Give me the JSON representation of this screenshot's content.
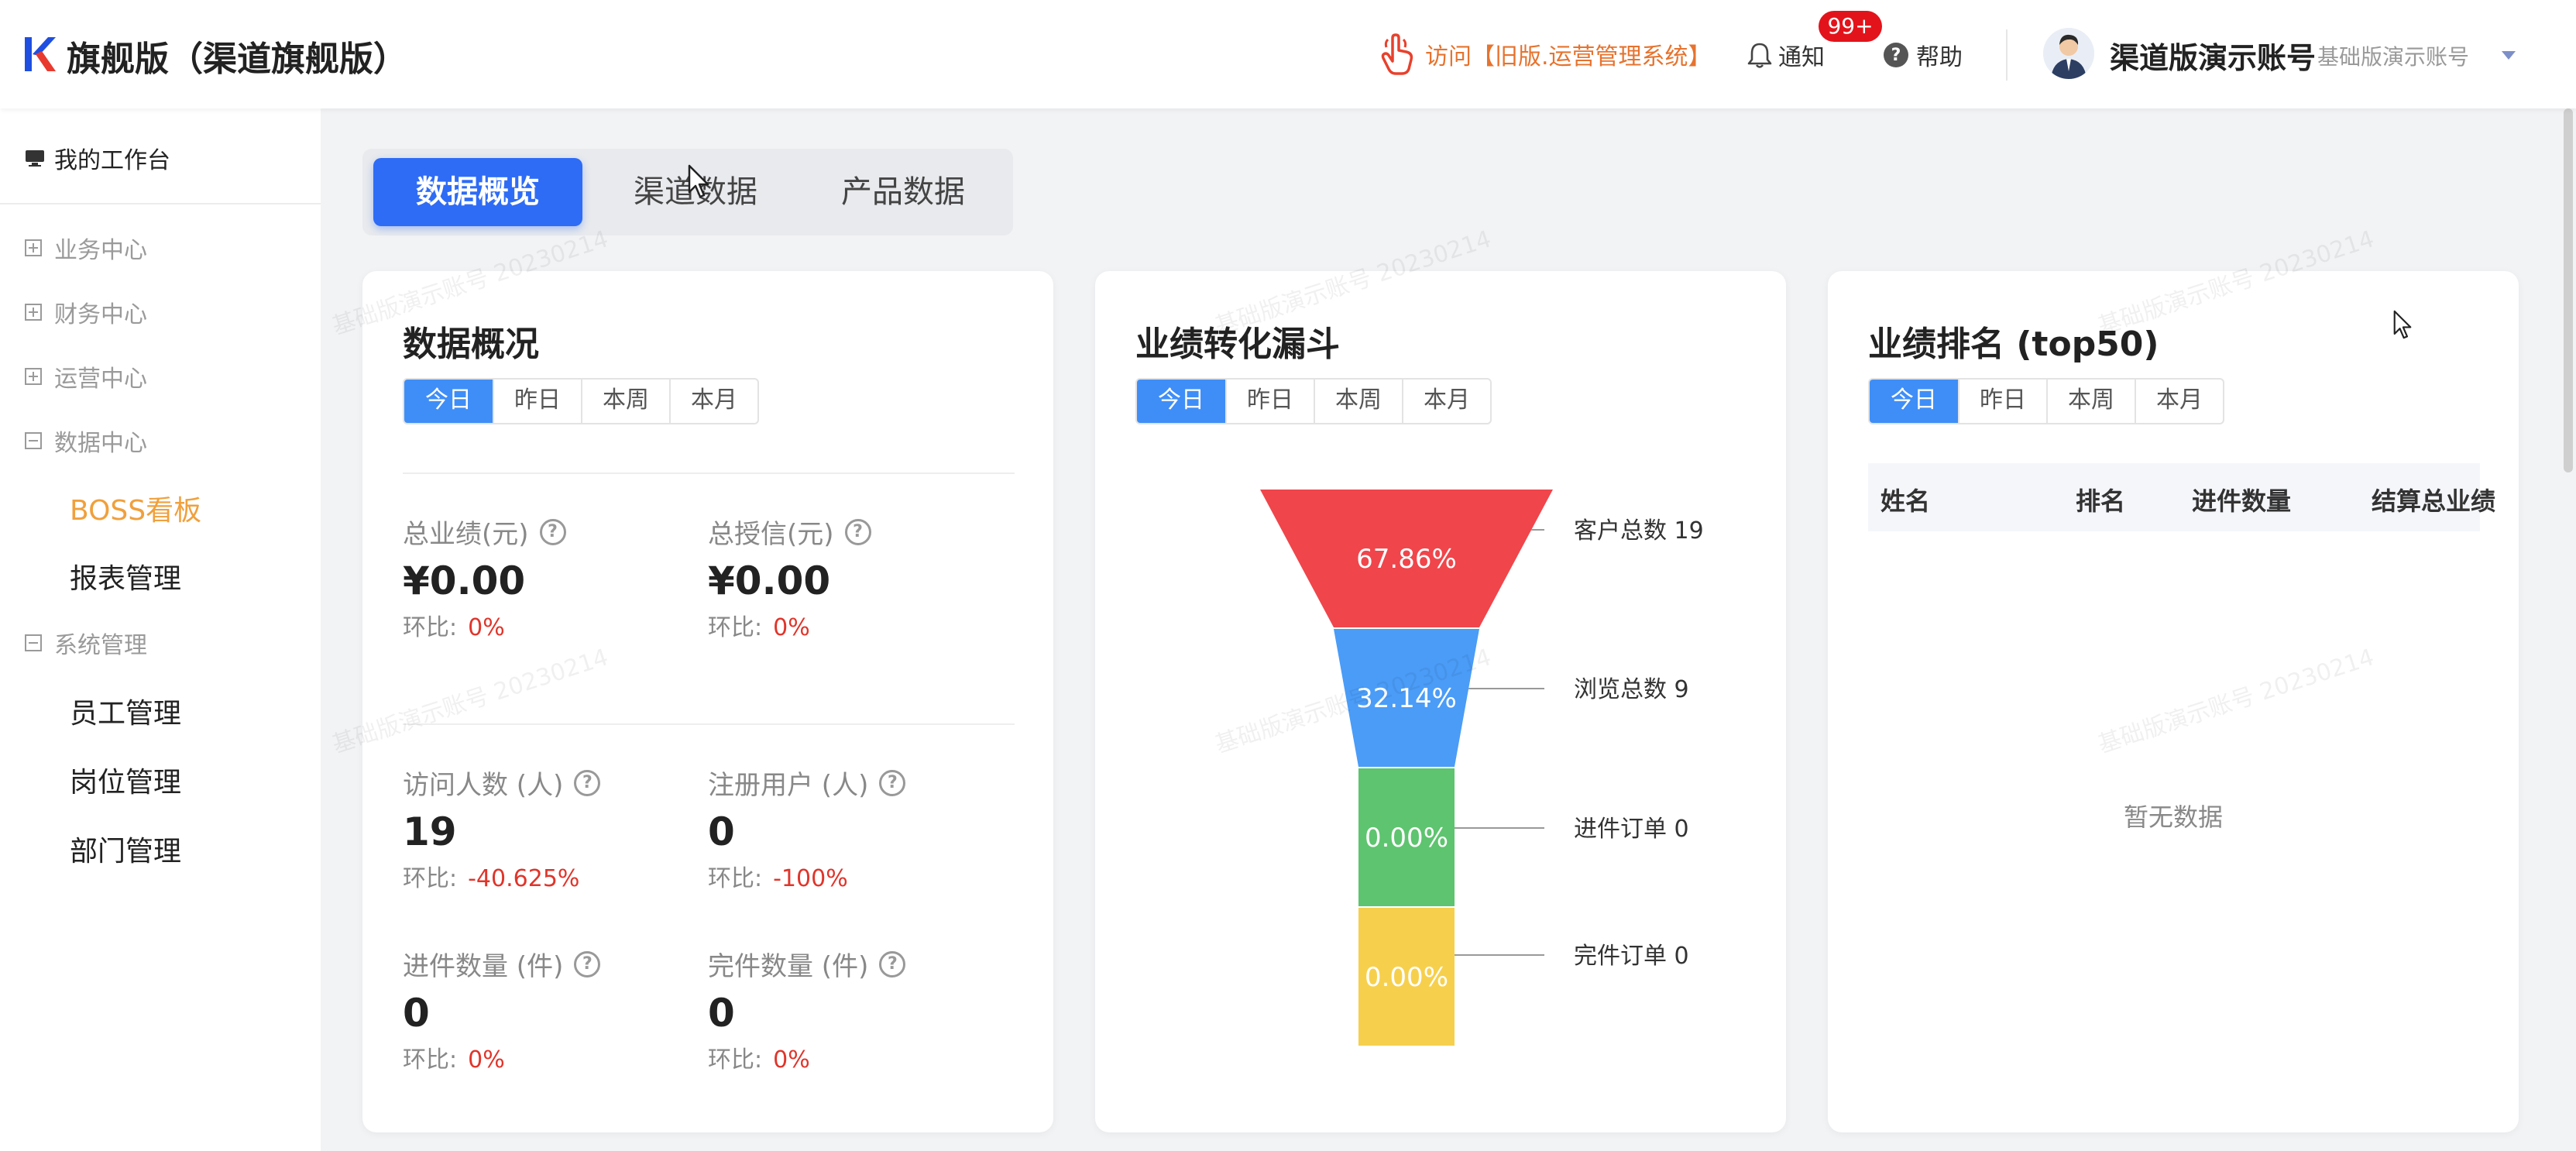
{
  "header": {
    "app_title": "旗舰版（渠道旗舰版）",
    "visit_link": "访问【旧版.运营管理系统】",
    "notify_label": "通知",
    "notify_badge": "99+",
    "help_label": "帮助",
    "user_name": "渠道版演示账号",
    "user_sub": "基础版演示账号",
    "icons": [
      "logo-k-icon",
      "hand-pointer-icon",
      "bell-icon",
      "question-circle-icon",
      "avatar",
      "caret-down-icon"
    ]
  },
  "sidebar": {
    "workbench": "我的工作台",
    "groups": [
      {
        "label": "业务中心",
        "state": "collapsed"
      },
      {
        "label": "财务中心",
        "state": "collapsed"
      },
      {
        "label": "运营中心",
        "state": "collapsed"
      },
      {
        "label": "数据中心",
        "state": "expanded"
      },
      {
        "label": "系统管理",
        "state": "expanded"
      }
    ],
    "items": [
      {
        "label": "BOSS看板",
        "active": true
      },
      {
        "label": "报表管理",
        "active": false
      },
      {
        "label": "员工管理",
        "active": false
      },
      {
        "label": "岗位管理",
        "active": false
      },
      {
        "label": "部门管理",
        "active": false
      }
    ]
  },
  "tabs": [
    {
      "label": "数据概览",
      "active": true
    },
    {
      "label": "渠道数据",
      "active": false
    },
    {
      "label": "产品数据",
      "active": false
    }
  ],
  "periods": [
    "今日",
    "昨日",
    "本周",
    "本月"
  ],
  "overview": {
    "title": "数据概况",
    "ratio_label": "环比:",
    "metrics": [
      {
        "label": "总业绩(元)",
        "value": "¥0.00",
        "ratio": "0%"
      },
      {
        "label": "总授信(元)",
        "value": "¥0.00",
        "ratio": "0%"
      },
      {
        "label": "访问人数 (人)",
        "value": "19",
        "ratio": "-40.625%"
      },
      {
        "label": "注册用户 (人)",
        "value": "0",
        "ratio": "-100%"
      },
      {
        "label": "进件数量 (件)",
        "value": "0",
        "ratio": "0%"
      },
      {
        "label": "完件数量 (件)",
        "value": "0",
        "ratio": "0%"
      }
    ]
  },
  "funnel_card": {
    "title": "业绩转化漏斗"
  },
  "chart_data": {
    "type": "funnel",
    "title": "业绩转化漏斗",
    "stages": [
      {
        "name": "客户总数",
        "value": 19,
        "percent": "67.86%",
        "color": "#f0454b"
      },
      {
        "name": "浏览总数",
        "value": 9,
        "percent": "32.14%",
        "color": "#4a9cf7"
      },
      {
        "name": "进件订单",
        "value": 0,
        "percent": "0.00%",
        "color": "#5ec46f"
      },
      {
        "name": "完件订单",
        "value": 0,
        "percent": "0.00%",
        "color": "#f6d04d"
      }
    ]
  },
  "ranking": {
    "title": "业绩排名 (top50)",
    "columns": [
      "姓名",
      "排名",
      "进件数量",
      "结算总业绩"
    ],
    "empty_text": "暂无数据"
  },
  "watermark_text": "基础版演示账号 20230214",
  "colors": {
    "primary": "#2e6cf6",
    "segment_active": "#3f8ef7",
    "active_menu": "#f0a03c",
    "visit_link": "#e6732e",
    "negative": "#e0352b",
    "badge": "#e3131b"
  }
}
